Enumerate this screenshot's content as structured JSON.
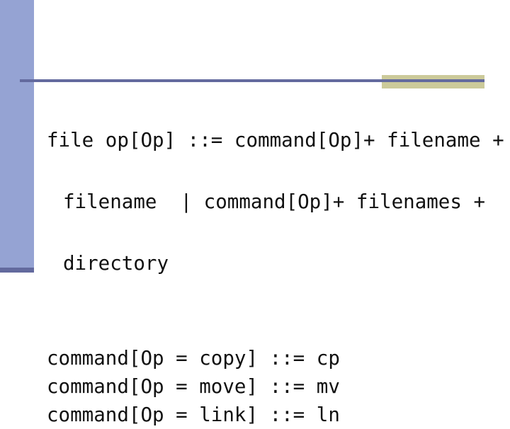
{
  "slide": {
    "background_color": "#ffffff",
    "decor": {
      "sidebar_color": "#95a3d3",
      "sidebar_foot_color": "#636a9e",
      "rule_color": "#636a9e",
      "accent_block_color": "#ccca9a"
    },
    "grammar": {
      "production_lines": [
        "file op[Op] ::= command[Op]+ filename +",
        "filename  | command[Op]+ filenames +",
        "directory"
      ],
      "rules": [
        "command[Op = copy] ::= cp",
        "command[Op = move] ::= mv",
        "command[Op = link] ::= ln"
      ]
    }
  }
}
